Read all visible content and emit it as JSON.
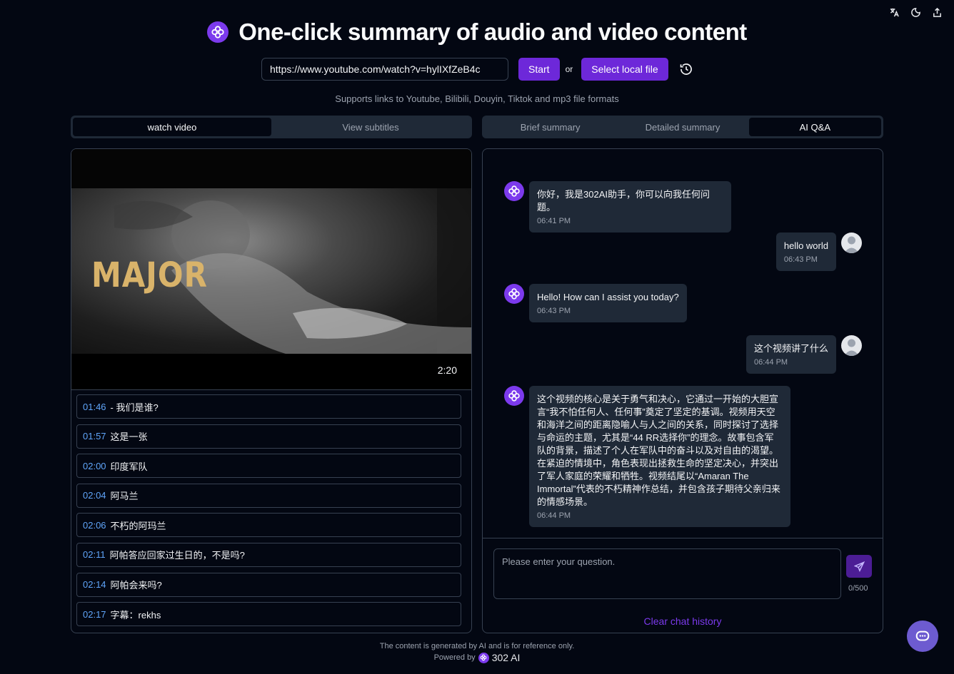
{
  "header": {
    "title": "One-click summary of audio and video content"
  },
  "input": {
    "url_value": "https://www.youtube.com/watch?v=hylIXfZeB4c",
    "start_label": "Start",
    "or_label": "or",
    "select_file_label": "Select local file",
    "supports_text": "Supports links to Youtube, Bilibili, Douyin, Tiktok and mp3 file formats"
  },
  "left_tabs": [
    "watch video",
    "View subtitles"
  ],
  "left_active_tab": "watch video",
  "right_tabs": [
    "Brief summary",
    "Detailed summary",
    "AI Q&A"
  ],
  "right_active_tab": "AI Q&A",
  "video": {
    "overlay_title": "MAJOR",
    "duration": "2:20"
  },
  "subtitles": [
    {
      "time": "01:46",
      "text": "- 我们是谁?"
    },
    {
      "time": "01:57",
      "text": "这是一张"
    },
    {
      "time": "02:00",
      "text": "印度军队"
    },
    {
      "time": "02:04",
      "text": "阿马兰"
    },
    {
      "time": "02:06",
      "text": "不朽的阿玛兰"
    },
    {
      "time": "02:11",
      "text": "阿帕答应回家过生日的，不是吗?"
    },
    {
      "time": "02:14",
      "text": "阿帕会来吗?"
    },
    {
      "time": "02:17",
      "text": "字幕：rekhs"
    }
  ],
  "chat": {
    "messages": [
      {
        "role": "assistant",
        "text": "你好，我是302AI助手，你可以向我任何问题。",
        "time": "06:41 PM"
      },
      {
        "role": "user",
        "text": "hello world",
        "time": "06:43 PM"
      },
      {
        "role": "assistant",
        "text": "Hello! How can I assist you today?",
        "time": "06:43 PM"
      },
      {
        "role": "user",
        "text": "这个视频讲了什么",
        "time": "06:44 PM"
      },
      {
        "role": "assistant",
        "text": "这个视频的核心是关于勇气和决心，它通过一开始的大胆宣言“我不怕任何人、任何事”奠定了坚定的基调。视频用天空和海洋之间的距离隐喻人与人之间的关系，同时探讨了选择与命运的主题，尤其是“44 RR选择你”的理念。故事包含军队的背景，描述了个人在军队中的奋斗以及对自由的渴望。在紧迫的情境中，角色表现出拯救生命的坚定决心，并突出了军人家庭的荣耀和牺牲。视频结尾以“Amaran The Immortal”代表的不朽精神作总结，并包含孩子期待父亲归来的情感场景。",
        "time": "06:44 PM"
      }
    ],
    "input_placeholder": "Please enter your question.",
    "counter": "0/500",
    "clear_label": "Clear chat history"
  },
  "footer": {
    "disclaimer": "The content is generated by AI and is for reference only.",
    "powered_by": "Powered by",
    "brand": "302 AI"
  },
  "colors": {
    "accent": "#6d28d9",
    "background": "#030712",
    "panel": "#1f2937",
    "link": "#60a5fa"
  }
}
